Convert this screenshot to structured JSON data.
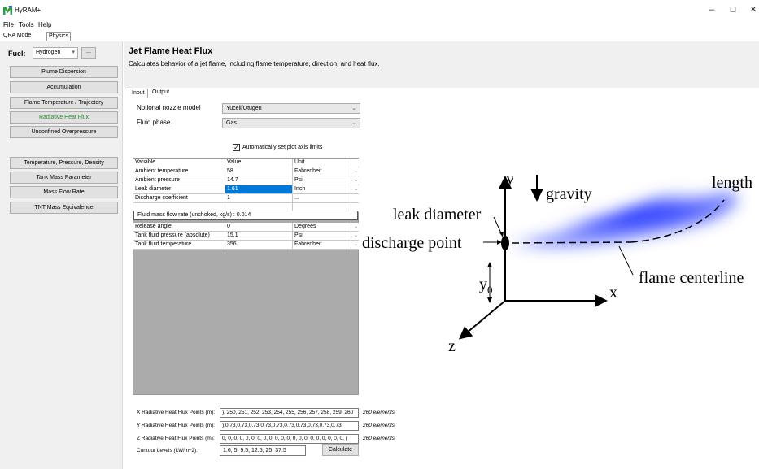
{
  "window": {
    "title": "HyRAM+",
    "minimize": "–",
    "maximize": "☐",
    "close": "✕"
  },
  "menu": [
    "File",
    "Tools",
    "Help"
  ],
  "mode_tabs": [
    "QRA Mode",
    "Physics"
  ],
  "fuel": {
    "label": "Fuel:",
    "selected": "Hydrogen",
    "more_label": "..."
  },
  "nav_buttons": [
    "Plume Dispersion",
    "Accumulation",
    "Flame Temperature / Trajectory",
    "Radiative Heat Flux",
    "Unconfined Overpressure",
    "Temperature, Pressure, Density",
    "Tank Mass Parameter",
    "Mass Flow Rate",
    "TNT Mass Equivalence"
  ],
  "active_nav": "Radiative Heat Flux",
  "page": {
    "title": "Jet Flame Heat Flux",
    "description": "Calculates behavior of a jet flame, including flame temperature, direction, and heat flux."
  },
  "io_tabs": [
    "Input",
    "Output"
  ],
  "form": {
    "nozzle_label": "Notional nozzle model",
    "nozzle_value": "Yuceil/Otugen",
    "phase_label": "Fluid phase",
    "phase_value": "Gas",
    "auto_axis_label": "Automatically set plot axis limits"
  },
  "grid": {
    "headers": [
      "Variable",
      "Value",
      "Unit"
    ],
    "rows": [
      {
        "variable": "Ambient temperature",
        "value": "58",
        "unit": "Fahrenheit"
      },
      {
        "variable": "Ambient pressure",
        "value": "14.7",
        "unit": "Psi"
      },
      {
        "variable": "Leak diameter",
        "value": "1.61",
        "unit": "Inch"
      },
      {
        "variable": "Discharge coefficient",
        "value": "1",
        "unit": "..."
      },
      {
        "variable": "",
        "value": "",
        "unit": ""
      },
      {
        "variable": "Release angle",
        "value": "0",
        "unit": "Degrees"
      },
      {
        "variable": "Tank fluid pressure (absolute)",
        "value": "15.1",
        "unit": "Psi"
      },
      {
        "variable": "Tank fluid temperature",
        "value": "356",
        "unit": "Fahrenheit"
      }
    ],
    "tooltip": "Fluid mass flow rate (unchoked, kg/s) : 0.014"
  },
  "flux_points": {
    "x_label": "X Radiative Heat Flux Points (m):",
    "x_value": "), 250, 251, 252, 253, 254, 255, 256, 257, 258, 259, 260",
    "y_label": "Y Radiative Heat Flux Points (m):",
    "y_value": "),0.73,0.73,0.73,0.73,0.73,0.73,0.73,0.73,0.73,0.73",
    "z_label": "Z Radiative Heat Flux Points (m):",
    "z_value": "0, 0, 0, 0, 0, 0, 0, 0, 0, 0, 0, 0, 0, 0, 0, 0, 0, 0, 0, 0, 0, (",
    "count": "260 elements"
  },
  "contour": {
    "label": "Contour Levels (kW/m^2):",
    "value": "1.6, 5, 9.5, 12.5, 25, 37.5"
  },
  "calculate_label": "Calculate",
  "diagram": {
    "y_axis": "y",
    "x_axis": "x",
    "z_axis": "z",
    "gravity": "gravity",
    "length": "length",
    "leak_diameter": "leak diameter",
    "discharge_point": "discharge point",
    "y0": "y",
    "y0_sub": "0",
    "flame_centerline": "flame centerline",
    "flame_color": "#1f2fff"
  }
}
